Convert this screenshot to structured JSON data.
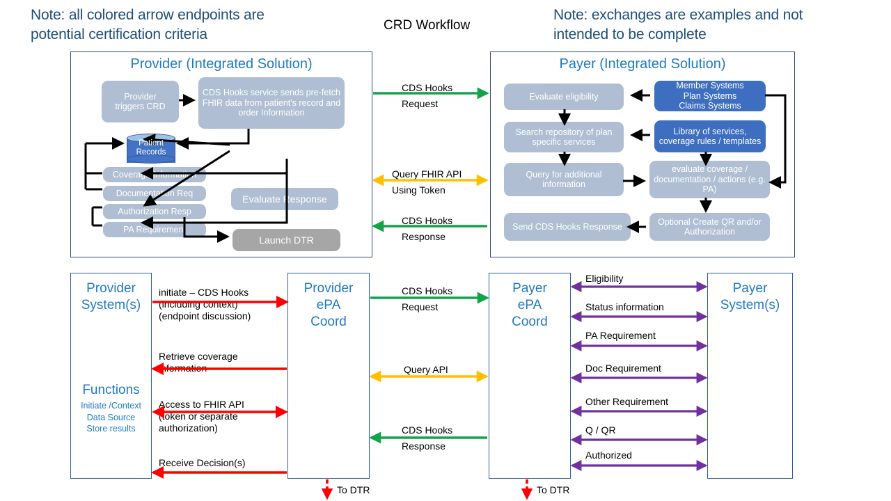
{
  "notes": {
    "left": "Note: all colored arrow endpoints are potential certification criteria",
    "right": "Note: exchanges are examples and not intended to be complete"
  },
  "title": "CRD Workflow",
  "colors": {
    "panel_border": "#2E4A7D",
    "lane_border": "#2E5FA3",
    "title_blue": "#1F7AC4",
    "note_blue": "#1F4E79",
    "process_fill": "#AFBED2",
    "system_fill": "#3D6EC0",
    "dtr_fill": "#A6A6A6",
    "green_arrow": "#13A349",
    "amber_arrow": "#FFC000",
    "red_arrow": "#FF0000",
    "purple_arrow": "#7030A0",
    "black_arrow": "#000000",
    "cylinder_body": "#4472C4",
    "cylinder_top": "#9DC3E6"
  },
  "provider_panel": {
    "title": "Provider (Integrated Solution)",
    "boxes": [
      {
        "id": "provider-triggers-crd",
        "label": "Provider\ntriggers CRD"
      },
      {
        "id": "cds-hooks-service",
        "label": "CDS Hooks  service sends pre-fetch FHIR  data from patient's record and order Information"
      },
      {
        "id": "patient-records",
        "label": "Patient\nRecords"
      },
      {
        "id": "coverage-information",
        "label": "Coverage  Information"
      },
      {
        "id": "documentation-req",
        "label": "Documentation Req"
      },
      {
        "id": "authorization-resp",
        "label": "Authorization Resp"
      },
      {
        "id": "pa-requirement",
        "label": "PA Requirement"
      },
      {
        "id": "evaluate-response",
        "label": "Evaluate Response"
      },
      {
        "id": "launch-dtr",
        "label": "Launch DTR"
      }
    ]
  },
  "payer_panel": {
    "title": "Payer (Integrated Solution)",
    "boxes": [
      {
        "id": "evaluate-eligibility",
        "label": "Evaluate eligibility"
      },
      {
        "id": "member-plan-claims-systems",
        "label": "Member Systems\nPlan Systems\nClaims Systems"
      },
      {
        "id": "search-repository",
        "label": "Search repository of plan specific  services"
      },
      {
        "id": "library-of-services",
        "label": "Library of services, coverage rules / templates"
      },
      {
        "id": "query-additional-information",
        "label": "Query for additional information"
      },
      {
        "id": "evaluate-coverage",
        "label": "evaluate coverage / documentation / actions (e.g. PA)"
      },
      {
        "id": "send-cds-hooks-response",
        "label": "Send CDS Hooks Response"
      },
      {
        "id": "optional-create-qr",
        "label": "Optional Create QR and/or Authorization"
      }
    ]
  },
  "top_exchanges": [
    {
      "id": "cds-hooks-request",
      "line1": "CDS Hooks",
      "line2": "Request",
      "color": "#13A349",
      "direction": "right"
    },
    {
      "id": "query-fhir-api",
      "line1": "Query FHIR API",
      "line2": "Using Token",
      "color": "#FFC000",
      "direction": "both"
    },
    {
      "id": "cds-hooks-response",
      "line1": "CDS Hooks",
      "line2": "Response",
      "color": "#13A349",
      "direction": "left"
    }
  ],
  "lanes": {
    "provider_systems": {
      "title": "Provider\nSystem(s)",
      "functions_heading": "Functions",
      "functions": "Initiate /Context\nData Source\nStore results"
    },
    "provider_epa": {
      "title": "Provider\nePA\nCoord"
    },
    "payer_epa": {
      "title": "Payer\nePA\nCoord"
    },
    "payer_systems": {
      "title": "Payer\nSystem(s)"
    }
  },
  "provider_internal_exchanges": [
    {
      "id": "initiate-cds-hooks",
      "lines": "initiate – CDS Hooks\n(including context)\n(endpoint discussion)",
      "color": "#FF0000",
      "direction": "right"
    },
    {
      "id": "retrieve-coverage-information",
      "lines": "Retrieve coverage\ninformation",
      "color": "#FF0000",
      "direction": "left"
    },
    {
      "id": "access-to-fhir-api",
      "lines": "Access to FHIR API\n(token or separate\nauthorization)",
      "color": "#FF0000",
      "direction": "both"
    },
    {
      "id": "receive-decisions",
      "lines": "Receive Decision(s)",
      "color": "#FF0000",
      "direction": "left"
    }
  ],
  "middle_exchanges": [
    {
      "id": "cds-hooks-request-lane",
      "line1": "CDS Hooks",
      "line2": "Request",
      "color": "#13A349",
      "direction": "right"
    },
    {
      "id": "query-api-lane",
      "line1": "Query API",
      "line2": "",
      "color": "#FFC000",
      "direction": "both"
    },
    {
      "id": "cds-hooks-response-lane",
      "line1": "CDS Hooks",
      "line2": "Response",
      "color": "#13A349",
      "direction": "left"
    }
  ],
  "payer_internal_exchanges": [
    {
      "id": "eligibility",
      "label": "Eligibility",
      "color": "#7030A0",
      "direction": "both"
    },
    {
      "id": "status-information",
      "label": "Status information",
      "color": "#7030A0",
      "direction": "both"
    },
    {
      "id": "pa-requirement-lane",
      "label": "PA Requirement",
      "color": "#7030A0",
      "direction": "both"
    },
    {
      "id": "doc-requirement",
      "label": "Doc Requirement",
      "color": "#7030A0",
      "direction": "both"
    },
    {
      "id": "other-requirement",
      "label": "Other Requirement",
      "color": "#7030A0",
      "direction": "both"
    },
    {
      "id": "q-qr",
      "label": "Q / QR",
      "color": "#7030A0",
      "direction": "both"
    },
    {
      "id": "authorized",
      "label": "Authorized",
      "color": "#7030A0",
      "direction": "both"
    }
  ],
  "dtr_links": [
    {
      "id": "to-dtr-provider",
      "label": "To DTR"
    },
    {
      "id": "to-dtr-payer",
      "label": "To DTR"
    }
  ]
}
